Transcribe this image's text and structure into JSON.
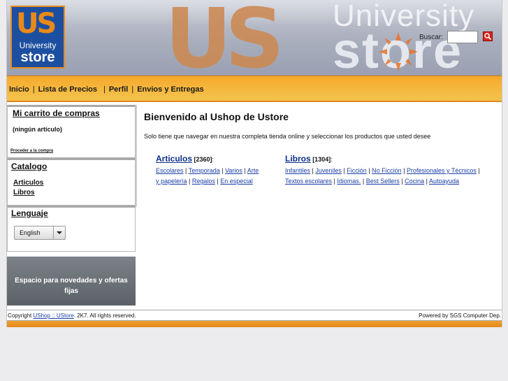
{
  "header": {
    "logo_big": "US",
    "logo_line1": "University",
    "logo_line2": "store",
    "banner_big": "US",
    "banner_university": "University",
    "banner_store": "store",
    "search_label": "Buscar:",
    "search_value": "",
    "search_button_icon": "search-icon"
  },
  "nav": {
    "items": [
      "Inicio",
      "Lista de Precios",
      "Perfil",
      "Envios y Entregas"
    ],
    "separator": "|"
  },
  "sidebar": {
    "cart": {
      "title": "Mi carrito de compras",
      "empty_text": "(ningún artículo)",
      "checkout_link": "Proceder a la compra"
    },
    "catalog": {
      "title": "Catalogo",
      "items": [
        "Articulos",
        "Libros"
      ]
    },
    "language": {
      "title": "Lenguaje",
      "selected": "English"
    },
    "promo": {
      "line1": "Espacio para novedades y ofertas",
      "line2": "fijas"
    }
  },
  "main": {
    "title": "Bienvenido al Ushop de Ustore",
    "intro": "Solo tiene que navegar en nuestra completa tienda online y seleccionar los productos que usted desee",
    "categories": [
      {
        "name": "Articulos",
        "count": "[2360]",
        "subs": [
          "Escolares",
          "Temporada",
          "Varios",
          "Arte y papelería",
          "Regalos",
          "En especial"
        ]
      },
      {
        "name": "Libros",
        "count": "[1304]",
        "subs": [
          "Infantiles",
          "Juveniles",
          "Ficción",
          "No Ficción",
          "Profesionales y Técnicos",
          "Textos escolares",
          "Idiomas.",
          "Best Sellers",
          "Cocina",
          "Autoayuda"
        ]
      }
    ]
  },
  "footer": {
    "copyright_prefix": "Copyright",
    "copyright_link": "UShop :: UStore",
    "copyright_suffix": ". 2K7. All rights reserved.",
    "powered_by": "Powered by SGS Computer Dep."
  },
  "colors": {
    "nav_orange": "#f5b63c",
    "logo_blue": "#1d4fa0",
    "logo_orange": "#e88a1a",
    "link_blue": "#1a3fa8",
    "promo_gray": "#5a6167"
  }
}
